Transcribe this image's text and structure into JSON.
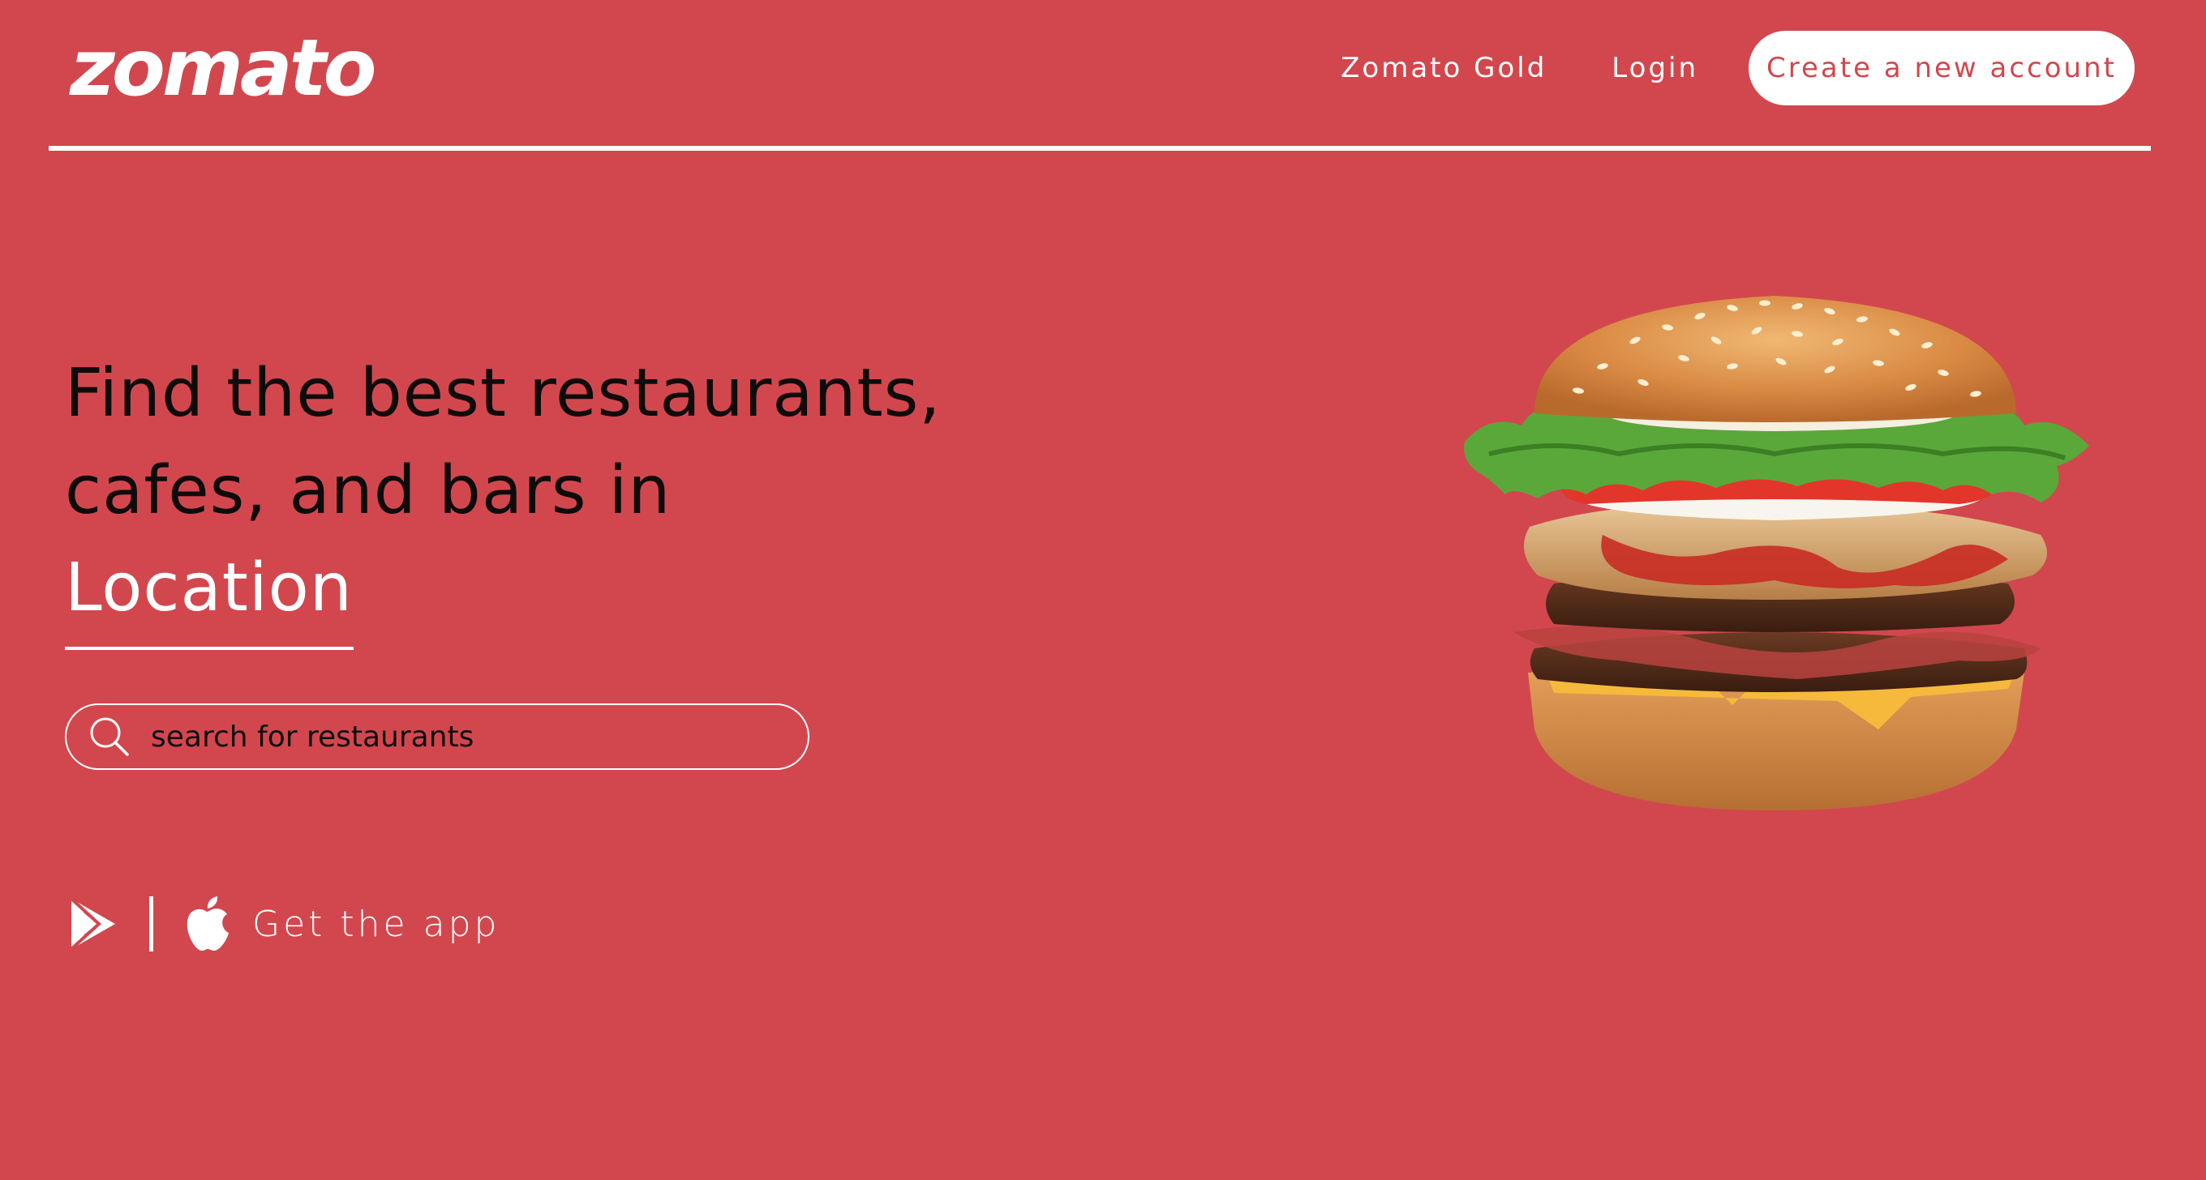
{
  "brand": {
    "logo_text": "zomato",
    "background_color": "#d2474e",
    "accent_white": "#ffffff",
    "text_dark": "#0f0b0c"
  },
  "nav": {
    "gold_label": "Zomato Gold",
    "login_label": "Login",
    "create_account_label": "Create a new account"
  },
  "hero": {
    "line1": "Find the best restaurants,",
    "line2": "cafes, and bars in",
    "location": "Location"
  },
  "search": {
    "icon": "search-icon",
    "placeholder": "search for restaurants"
  },
  "app": {
    "play_icon": "google-play-icon",
    "apple_icon": "apple-icon",
    "label": "Get the app"
  },
  "hero_image": {
    "alt": "burger"
  }
}
